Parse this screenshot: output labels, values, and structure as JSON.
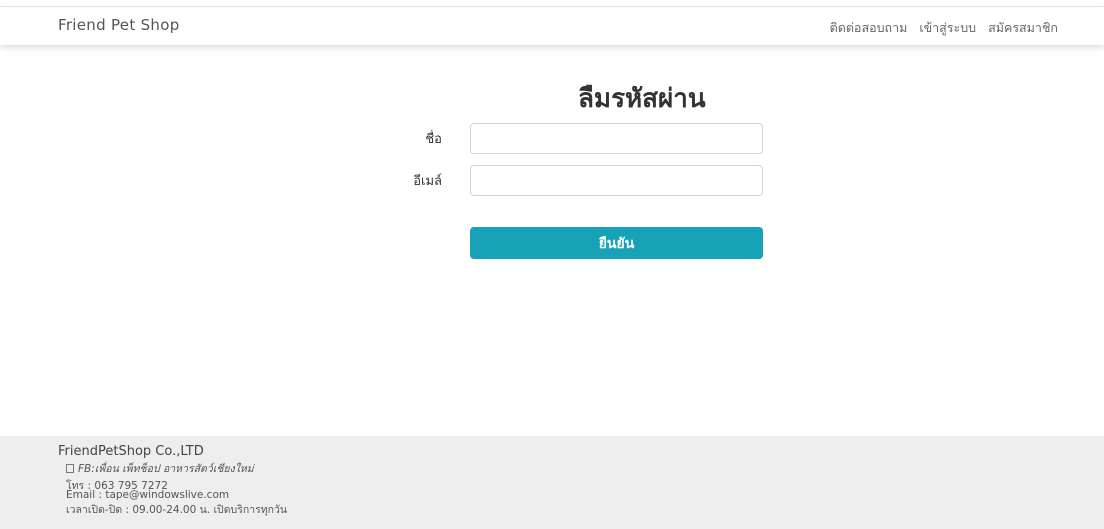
{
  "navbar": {
    "brand": "Friend Pet Shop",
    "links": [
      {
        "label": "ติดต่อสอบถาม"
      },
      {
        "label": "เข้าสู่ระบบ"
      },
      {
        "label": "สมัครสมาชิก"
      }
    ]
  },
  "form": {
    "title": "ลืมรหัสผ่าน",
    "name_label": "ชื่อ",
    "name_value": "",
    "email_label": "อีเมล์",
    "email_value": "",
    "submit_label": "ยืนยัน"
  },
  "footer": {
    "company": "FriendPetShop Co.,LTD",
    "facebook": "FB:เพื่อน เพ็ทช็อป อาหารสัตว์เชียงใหม่",
    "phone": "โทร : 063 795 7272",
    "email": "Email : tape@windowslive.com",
    "hours": "เวลาเปิด-ปิด : 09.00-24.00 น. เปิดบริการทุกวัน"
  },
  "colors": {
    "accent": "#17a2b8",
    "footer_bg": "#eeeeee"
  }
}
